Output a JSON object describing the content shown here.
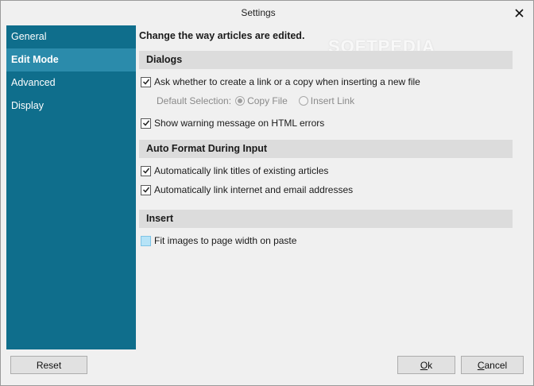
{
  "window": {
    "title": "Settings",
    "watermark": "SOFTPEDIA"
  },
  "sidebar": {
    "items": [
      {
        "label": "General",
        "active": false
      },
      {
        "label": "Edit Mode",
        "active": true
      },
      {
        "label": "Advanced",
        "active": false
      },
      {
        "label": "Display",
        "active": false
      }
    ],
    "color": "#0f6e8c",
    "active_color": "#2b8bab"
  },
  "content": {
    "heading": "Change the way articles are edited.",
    "dialogs": {
      "title": "Dialogs",
      "ask_link_or_copy": {
        "label": "Ask whether to create a link or a copy when inserting a new file",
        "checked": true
      },
      "default_selection_label": "Default Selection:",
      "copy_file": {
        "label": "Copy File",
        "selected": true
      },
      "insert_link": {
        "label": "Insert Link",
        "selected": false
      },
      "warn_html_errors": {
        "label": "Show warning message on HTML errors",
        "checked": true
      }
    },
    "auto_format": {
      "title": "Auto Format During Input",
      "link_titles": {
        "label": "Automatically link titles of existing articles",
        "checked": true
      },
      "link_addresses": {
        "label": "Automatically link internet and email addresses",
        "checked": true
      }
    },
    "insert": {
      "title": "Insert",
      "fit_images": {
        "label": "Fit images to page width on paste",
        "checked": false
      }
    }
  },
  "buttons": {
    "reset": "Reset",
    "ok_mnemonic": "O",
    "ok_rest": "k",
    "cancel_mnemonic": "C",
    "cancel_rest": "ancel"
  }
}
